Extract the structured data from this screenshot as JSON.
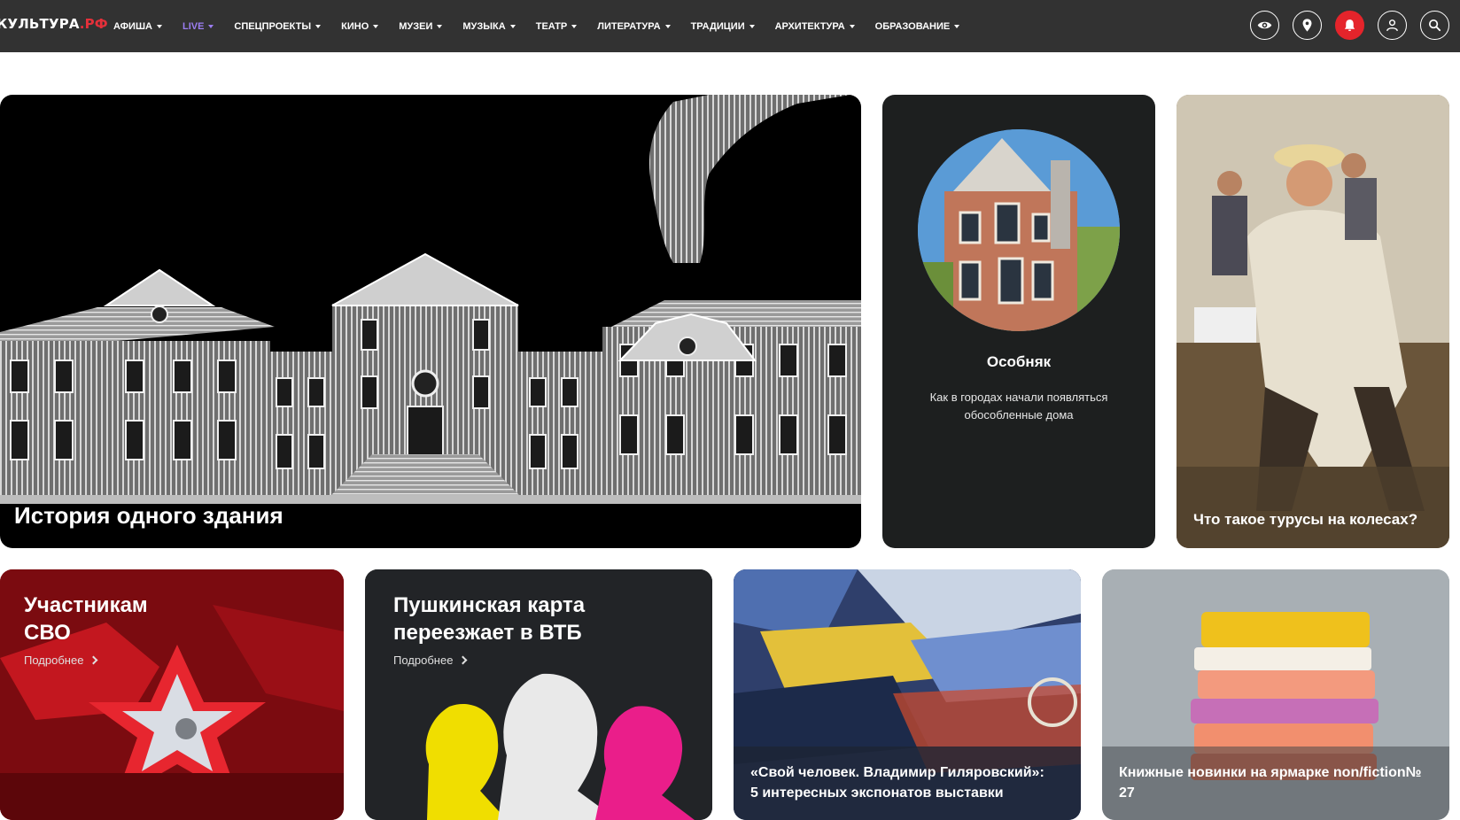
{
  "header": {
    "logo_text": "КУЛЬТУРА",
    "logo_suffix": ".РФ",
    "nav": [
      {
        "label": "АФИША"
      },
      {
        "label": "LIVE"
      },
      {
        "label": "СПЕЦПРОЕКТЫ"
      },
      {
        "label": "КИНО"
      },
      {
        "label": "МУЗЕИ"
      },
      {
        "label": "МУЗЫКА"
      },
      {
        "label": "ТЕАТР"
      },
      {
        "label": "ЛИТЕРАТУРА"
      },
      {
        "label": "ТРАДИЦИИ"
      },
      {
        "label": "АРХИТЕКТУРА"
      },
      {
        "label": "ОБРАЗОВАНИЕ"
      }
    ],
    "active_nav": "LIVE",
    "icons": [
      "eye-icon",
      "location-pin-icon",
      "bell-icon",
      "user-icon",
      "search-icon"
    ]
  },
  "cards": {
    "main": {
      "title": "История одного здания"
    },
    "mansion": {
      "title": "Особняк",
      "subtitle": "Как в городах начали появляться обособленные дома"
    },
    "painting": {
      "title": "Что такое турусы на колесах?"
    },
    "svo": {
      "title_line1": "Участникам",
      "title_line2": "СВО",
      "more": "Подробнее"
    },
    "pushkin": {
      "title_line1": "Пушкинская карта",
      "title_line2": "переезжает в ВТБ",
      "more": "Подробнее"
    },
    "exhibit": {
      "title_line1": "«Свой человек. Владимир Гиляровский»:",
      "title_line2": "5 интересных экспонатов выставки"
    },
    "books": {
      "title_line1": "Книжные новинки на ярмарке non/fiction№",
      "title_line2": "27"
    }
  },
  "colors": {
    "header_bg": "#323232",
    "accent_red": "#e5242b",
    "active_nav": "#9b7df1"
  }
}
